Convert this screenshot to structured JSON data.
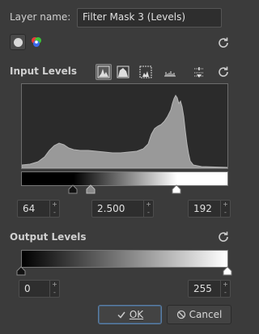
{
  "layer_name_label": "Layer name:",
  "layer_name_value": "Filter Mask 3 (Levels)",
  "input_levels": {
    "title": "Input Levels",
    "black": "64",
    "gamma": "2.500",
    "white": "192"
  },
  "output_levels": {
    "title": "Output Levels",
    "black": "0",
    "white": "255"
  },
  "buttons": {
    "ok": "OK",
    "cancel": "Cancel"
  },
  "spin": {
    "up": "+",
    "down": "-"
  },
  "colors": {
    "background": "#3b3b3b",
    "histogram_fill": "#9a9a9a",
    "ok_border": "#5a7fa6"
  }
}
